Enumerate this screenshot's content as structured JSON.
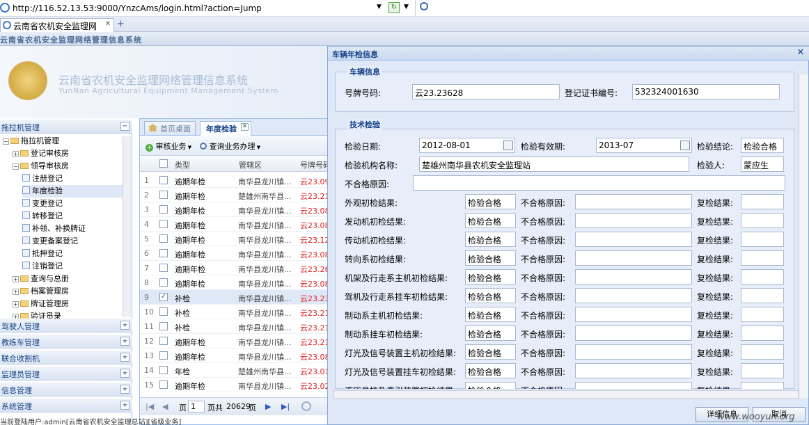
{
  "browser": {
    "url": "http://116.52.13.53:9000/YnzcAms/login.html?action=Jump",
    "tab_title": "云南省农机安全监理网",
    "close": "✕",
    "newtab": "+"
  },
  "app": {
    "header": "云南省农机安全监理网络管理信息系统",
    "banner_title": "云南省农机安全监理网络管理信息系统",
    "banner_subtitle": "YunNan Agricultural Equipment Management System"
  },
  "nav": {
    "title": "拖拉机管理",
    "tree": [
      {
        "label": "拖拉机管理",
        "type": "folder",
        "level": 0
      },
      {
        "label": "登记审核房",
        "type": "folder",
        "level": 1
      },
      {
        "label": "领导审核房",
        "type": "folder",
        "level": 1
      },
      {
        "label": "注册登记",
        "type": "leaf",
        "level": 2
      },
      {
        "label": "年度检验",
        "type": "leaf",
        "level": 2,
        "selected": true
      },
      {
        "label": "变更登记",
        "type": "leaf",
        "level": 2
      },
      {
        "label": "转移登记",
        "type": "leaf",
        "level": 2
      },
      {
        "label": "补领、补换牌证",
        "type": "leaf",
        "level": 2
      },
      {
        "label": "变更备案登记",
        "type": "leaf",
        "level": 2
      },
      {
        "label": "抵押登记",
        "type": "leaf",
        "level": 2
      },
      {
        "label": "注销登记",
        "type": "leaf",
        "level": 2
      },
      {
        "label": "查询与总册",
        "type": "folder",
        "level": 1
      },
      {
        "label": "档案管理房",
        "type": "folder",
        "level": 1
      },
      {
        "label": "牌证管理房",
        "type": "folder",
        "level": 1
      },
      {
        "label": "验证员录",
        "type": "folder",
        "level": 1
      }
    ],
    "sections": [
      "驾驶人管理",
      "教练车管理",
      "联合收割机",
      "监理员管理",
      "信息管理",
      "系统管理"
    ]
  },
  "grid": {
    "tabs": [
      "首页桌面",
      "年度检验"
    ],
    "toolbar": [
      "审核业务",
      "查询业务办理"
    ],
    "columns": [
      "类型",
      "管辖区",
      "号牌号码"
    ],
    "rows": [
      {
        "n": "1",
        "type": "逾期年检",
        "area": "南华县龙川镇...",
        "plate": "云23.09"
      },
      {
        "n": "2",
        "type": "逾期年检",
        "area": "楚雄州南华县...",
        "plate": "云23.21"
      },
      {
        "n": "3",
        "type": "逾期年检",
        "area": "南华县龙川镇...",
        "plate": "云23.08"
      },
      {
        "n": "4",
        "type": "逾期年检",
        "area": "南华县龙川镇...",
        "plate": "云23.08"
      },
      {
        "n": "5",
        "type": "逾期年检",
        "area": "南华县龙川镇...",
        "plate": "云23.12"
      },
      {
        "n": "6",
        "type": "逾期年检",
        "area": "南华县龙川镇...",
        "plate": "云23.08"
      },
      {
        "n": "7",
        "type": "逾期年检",
        "area": "南华县龙川镇...",
        "plate": "云23.26"
      },
      {
        "n": "8",
        "type": "逾期年检",
        "area": "南华县龙川镇...",
        "plate": "云23.08"
      },
      {
        "n": "9",
        "type": "补检",
        "area": "南华县龙川镇...",
        "plate": "云23.23",
        "selected": true
      },
      {
        "n": "10",
        "type": "补检",
        "area": "南华县龙川镇...",
        "plate": "云23.21"
      },
      {
        "n": "11",
        "type": "补检",
        "area": "南华县龙川镇...",
        "plate": "云23.21"
      },
      {
        "n": "12",
        "type": "逾期年检",
        "area": "南华县龙川镇...",
        "plate": "云23.21"
      },
      {
        "n": "13",
        "type": "逾期年检",
        "area": "南华县龙川镇...",
        "plate": "云23.08"
      },
      {
        "n": "14",
        "type": "年检",
        "area": "楚雄州南华县...",
        "plate": "云23.01"
      },
      {
        "n": "15",
        "type": "逾期年检",
        "area": "南华县龙川镇...",
        "plate": "云23.02"
      }
    ],
    "pager": {
      "page_label": "页",
      "page": "1",
      "total_label": "页共",
      "total": "20629",
      "page_suffix": "页"
    }
  },
  "dialog": {
    "title": "车辆年检信息",
    "vehicle_section": "车辆信息",
    "plate_label": "号牌号码:",
    "plate_value": "云23.23628",
    "cert_label": "登记证书编号:",
    "cert_value": "532324001630",
    "tech_section": "技术检验",
    "check_date_label": "检验日期:",
    "check_date": "2012-08-01",
    "valid_label": "检验有效期:",
    "valid_value": "2013-07",
    "conclusion_label": "检验结论:",
    "conclusion": "检验合格",
    "station_label": "检验机构名称:",
    "station": "楚雄州南华县农机安全监理站",
    "inspector_label": "检验人:",
    "inspector": "蒙应生",
    "reason_label": "不合格原因:",
    "reason": "",
    "fail_label": "不合格原因:",
    "recheck_label": "复检结果:",
    "items": [
      {
        "label": "外观初检结果:",
        "value": "检验合格"
      },
      {
        "label": "发动机初检结果:",
        "value": "检验合格"
      },
      {
        "label": "传动机初检结果:",
        "value": "检验合格"
      },
      {
        "label": "转向系初检结果:",
        "value": "检验合格"
      },
      {
        "label": "机架及行走系主机初检结果:",
        "value": "检验合格"
      },
      {
        "label": "驾机及行走系挂车初检结果:",
        "value": "检验合格"
      },
      {
        "label": "制动系主机初检结果:",
        "value": "检验合格"
      },
      {
        "label": "制动系挂车初检结果:",
        "value": "检验合格"
      },
      {
        "label": "灯光及信号装置主机初检结果:",
        "value": "检验合格"
      },
      {
        "label": "灯光及信号装置挂车初检结果:",
        "value": "检验合格"
      },
      {
        "label": "液压悬挂及牵引装置初检结果:",
        "value": "检验合格"
      }
    ],
    "btn_detail": "详细信息",
    "btn_cancel": "取消"
  },
  "status": "当前登陆用户:admin[云南省农机安全监理总站][省级业务]",
  "watermark": "www.wooyun.org"
}
